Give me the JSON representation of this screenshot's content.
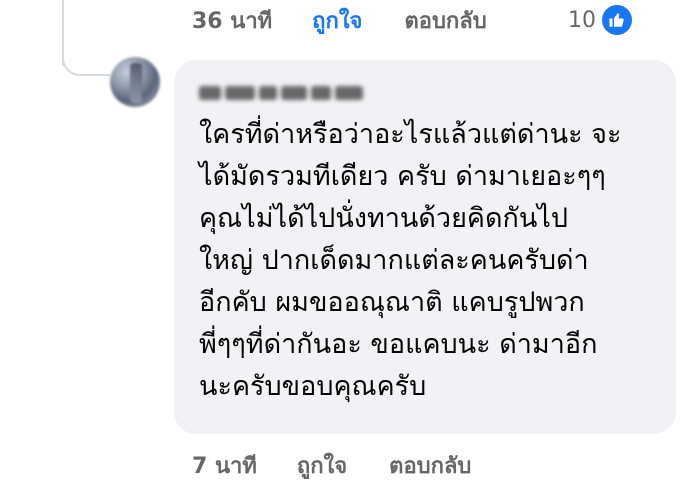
{
  "previous_comment": {
    "time": "36 นาที",
    "like_label": "ถูกใจ",
    "reply_label": "ตอบกลับ",
    "reaction_count": "10",
    "reaction_icon": "like-thumb-icon",
    "liked_color": "#1877f2"
  },
  "comment": {
    "author_name_blurred": "",
    "lines": [
      "ใครที่ด่าหรือว่าอะไรแล้วแต่ด่านะ จะ",
      "ได้มัดรวมทีเดียว ครับ ด่ามาเยอะๆๆ",
      "คุณไม่ได้ไปนั่งทานด้วยคิดกันไป",
      "ใหญ่ ปากเด็ดมากแต่ละคนครับด่า",
      "อีกคับ ผมขออณุณาติ แคบรูปพวก",
      "พี่ๆๆที่ด่ากันอะ ขอแคบนะ ด่ามาอีก",
      "นะครับขอบคุณครับ"
    ]
  },
  "reply_actions": {
    "time": "7 นาที",
    "like_label": "ถูกใจ",
    "reply_label": "ตอบกลับ"
  },
  "colors": {
    "bubble_bg": "#f0f2f5",
    "meta_text": "#65676b",
    "thread_line": "#d7dadf"
  }
}
